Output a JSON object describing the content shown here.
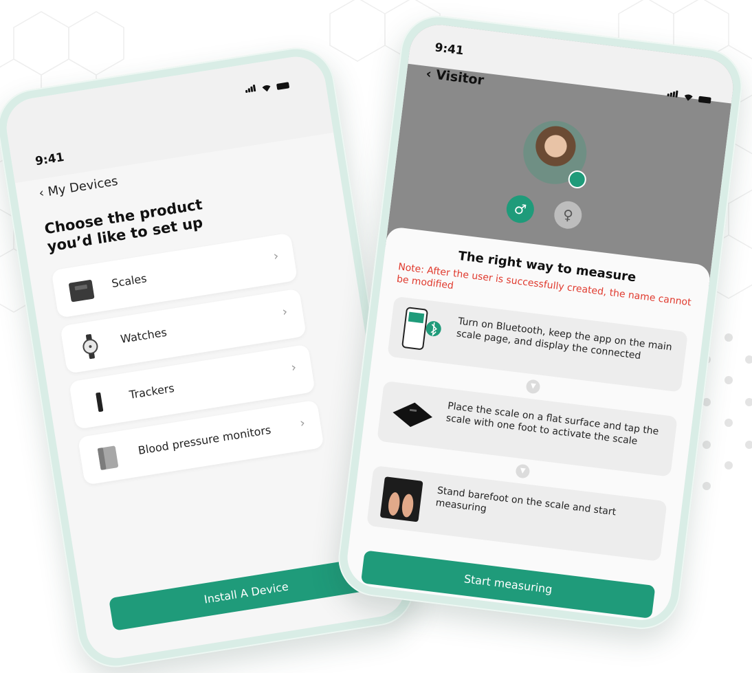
{
  "colors": {
    "accent": "#1f9b7a",
    "warning": "#e03a2e",
    "frame": "#d9ede6"
  },
  "left_screen": {
    "time": "9:41",
    "back_label": "My Devices",
    "title": "Choose the product you’d like to set up",
    "items": [
      {
        "label": "Scales",
        "icon": "scale-icon"
      },
      {
        "label": "Watches",
        "icon": "watch-icon"
      },
      {
        "label": "Trackers",
        "icon": "tracker-icon"
      },
      {
        "label": "Blood pressure monitors",
        "icon": "blood-pressure-monitor-icon"
      }
    ],
    "install_button": "Install A Device"
  },
  "right_screen": {
    "time": "9:41",
    "back_label": "Visitor",
    "gender_male_icon": "♂",
    "gender_female_icon": "♀",
    "sheet_title": "The right way to measure",
    "note": "Note: After the user is successfully created, the name cannot be modified",
    "steps": [
      {
        "text": "Turn on Bluetooth, keep the app on the main scale page, and display the connected",
        "icon": "phone-bluetooth-icon"
      },
      {
        "text": "Place the scale on a flat surface and tap the scale with one foot to activate the scale",
        "icon": "scale-icon"
      },
      {
        "text": "Stand barefoot on the scale and start measuring",
        "icon": "feet-on-scale-icon"
      }
    ],
    "start_button": "Start measuring"
  }
}
